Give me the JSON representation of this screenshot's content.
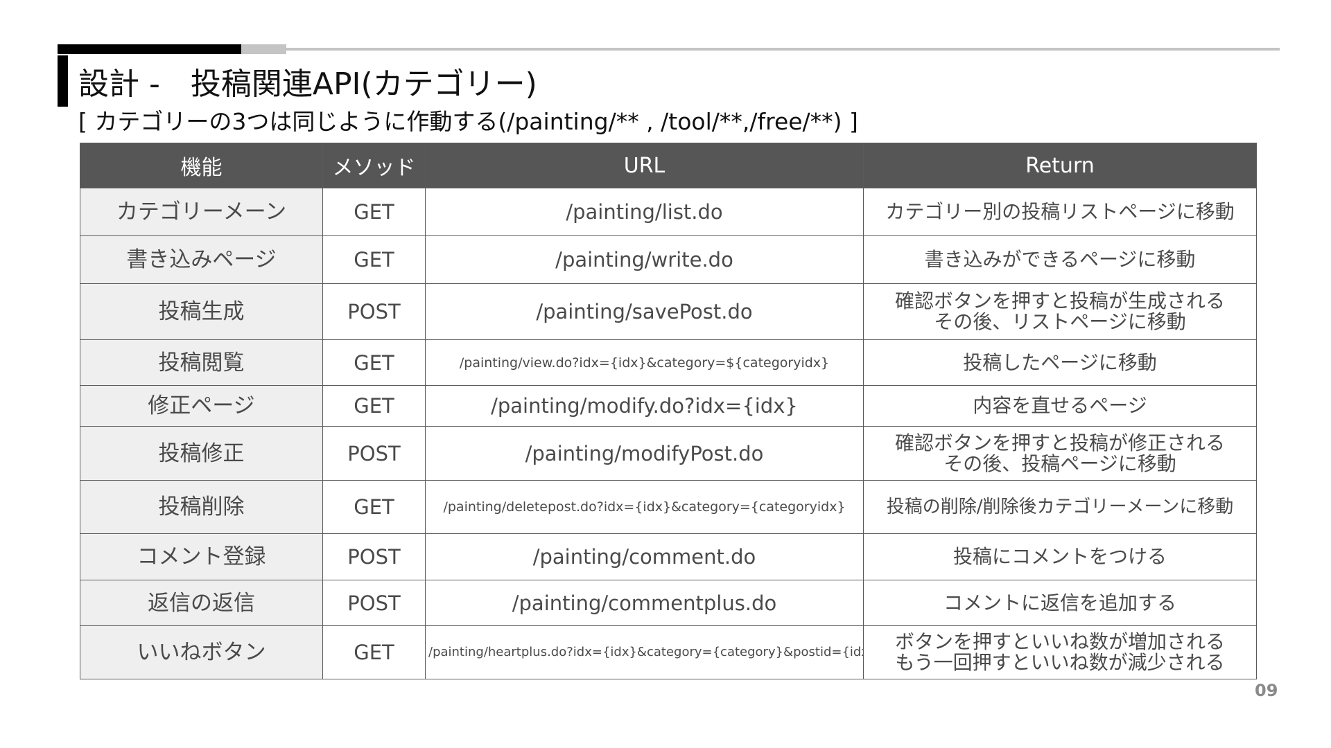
{
  "header": {
    "title": "設計 -　投稿関連API(カテゴリー)",
    "subtitle": "[ カテゴリーの3つは同じように作動する(/painting/** , /tool/**,/free/**) ]"
  },
  "table": {
    "columns": [
      "機能",
      "メソッド",
      "URL",
      "Return"
    ],
    "rows": [
      {
        "feature": "カテゴリーメーン",
        "method": "GET",
        "url": "/painting/list.do",
        "ret": [
          "カテゴリー別の投稿リストページに移動"
        ]
      },
      {
        "feature": "書き込みページ",
        "method": "GET",
        "url": "/painting/write.do",
        "ret": [
          "書き込みができるページに移動"
        ]
      },
      {
        "feature": "投稿生成",
        "method": "POST",
        "url": "/painting/savePost.do",
        "ret": [
          "確認ボタンを押すと投稿が生成される",
          "その後、リストページに移動"
        ]
      },
      {
        "feature": "投稿閲覧",
        "method": "GET",
        "url": "/painting/view.do?idx={idx}&category=${categoryidx}",
        "ret": [
          "投稿したページに移動"
        ]
      },
      {
        "feature": "修正ページ",
        "method": "GET",
        "url": "/painting/modify.do?idx={idx}",
        "ret": [
          "内容を直せるページ"
        ]
      },
      {
        "feature": "投稿修正",
        "method": "POST",
        "url": "/painting/modifyPost.do",
        "ret": [
          "確認ボタンを押すと投稿が修正される",
          "その後、投稿ページに移動"
        ]
      },
      {
        "feature": "投稿削除",
        "method": "GET",
        "url": "/painting/deletepost.do?idx={idx}&category={categoryidx}",
        "ret": [
          "投稿の削除/削除後カテゴリーメーンに移動"
        ]
      },
      {
        "feature": "コメント登録",
        "method": "POST",
        "url": "/painting/comment.do",
        "ret": [
          "投稿にコメントをつける"
        ]
      },
      {
        "feature": "返信の返信",
        "method": "POST",
        "url": "/painting/commentplus.do",
        "ret": [
          "コメントに返信を追加する"
        ]
      },
      {
        "feature": "いいねボタン",
        "method": "GET",
        "url": "/painting/heartplus.do?idx={idx}&category={category}&postid={idx}",
        "ret": [
          "ボタンを押すといいね数が増加される",
          "もう一回押すといいね数が減少される"
        ]
      }
    ]
  },
  "page_number": "09"
}
